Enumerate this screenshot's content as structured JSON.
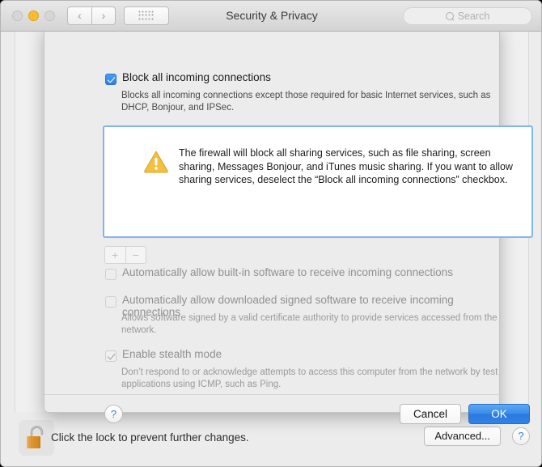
{
  "window": {
    "title": "Security & Privacy",
    "traffic_lights": [
      "close",
      "minimize",
      "zoom"
    ],
    "nav": {
      "back_icon": "chevron-left-icon",
      "forward_icon": "chevron-right-icon",
      "grid_icon": "show-all-grid-icon"
    },
    "search": {
      "placeholder": "Search",
      "value": "",
      "icon": "search-icon"
    }
  },
  "sheet": {
    "block_all": {
      "label": "Block all incoming connections",
      "checked": true,
      "description": "Blocks all incoming connections except those required for basic Internet services, such as DHCP, Bonjour, and IPSec."
    },
    "warning": {
      "icon": "warning-triangle-icon",
      "text": "The firewall will block all sharing services, such as file sharing, screen sharing, Messages Bonjour, and iTunes music sharing. If you want to allow sharing services, deselect the “Block all incoming connections” checkbox."
    },
    "list_controls": {
      "add_label": "+",
      "remove_label": "−",
      "enabled": false
    },
    "auto_builtin": {
      "label": "Automatically allow built-in software to receive incoming connections",
      "checked": false,
      "enabled": false
    },
    "auto_signed": {
      "label": "Automatically allow downloaded signed software to receive incoming connections",
      "checked": false,
      "enabled": false,
      "description": "Allows software signed by a valid certificate authority to provide services accessed from the network."
    },
    "stealth": {
      "label": "Enable stealth mode",
      "checked": true,
      "enabled": false,
      "description": "Don’t respond to or acknowledge attempts to access this computer from the network by test applications using ICMP, such as Ping."
    },
    "help_label": "?",
    "cancel_label": "Cancel",
    "ok_label": "OK"
  },
  "bottom_bar": {
    "lock_icon": "unlocked-padlock-icon",
    "lock_message": "Click the lock to prevent further changes.",
    "advanced_label": "Advanced...",
    "help_label": "?"
  },
  "colors": {
    "accent_blue": "#2f7fe0",
    "warning_yellow": "#f6c445",
    "focus_ring": "#7fb6ec",
    "window_bg": "#ececec",
    "lock_gold": "#e8a33d"
  }
}
